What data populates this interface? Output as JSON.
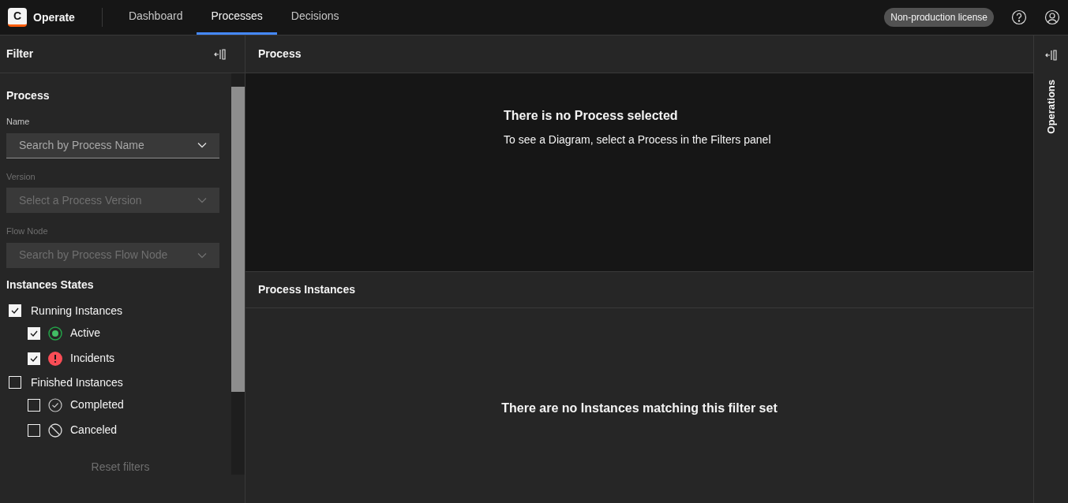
{
  "header": {
    "logo_letter": "C",
    "app_name": "Operate",
    "tabs": [
      {
        "label": "Dashboard",
        "selected": false
      },
      {
        "label": "Processes",
        "selected": true
      },
      {
        "label": "Decisions",
        "selected": false
      }
    ],
    "license": "Non-production license"
  },
  "filter": {
    "title": "Filter",
    "section": "Process",
    "fields": [
      {
        "label": "Name",
        "placeholder": "Search by Process Name",
        "disabled": false
      },
      {
        "label": "Version",
        "placeholder": "Select a Process Version",
        "disabled": true
      },
      {
        "label": "Flow Node",
        "placeholder": "Search by Process Flow Node",
        "disabled": true
      }
    ],
    "states_title": "Instances States",
    "states": [
      {
        "label": "Running Instances",
        "checked": true,
        "children": [
          {
            "label": "Active",
            "checked": true,
            "kind": "active"
          },
          {
            "label": "Incidents",
            "checked": true,
            "kind": "incident"
          }
        ]
      },
      {
        "label": "Finished Instances",
        "checked": false,
        "children": [
          {
            "label": "Completed",
            "checked": false,
            "kind": "completed"
          },
          {
            "label": "Canceled",
            "checked": false,
            "kind": "canceled"
          }
        ]
      }
    ],
    "reset": "Reset filters"
  },
  "process": {
    "title": "Process",
    "empty_title": "There is no Process selected",
    "empty_text": "To see a Diagram, select a Process in the Filters panel"
  },
  "instances": {
    "title": "Process Instances",
    "empty_text": "There are no Instances matching this filter set"
  },
  "operations": {
    "title": "Operations"
  }
}
